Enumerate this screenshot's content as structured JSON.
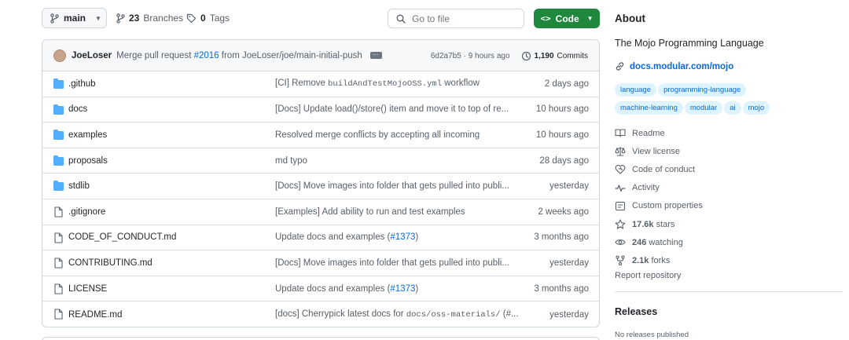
{
  "toolbar": {
    "branch": "main",
    "branches_count": "23",
    "branches_label": "Branches",
    "tags_count": "0",
    "tags_label": "Tags",
    "goto_placeholder": "Go to file",
    "code_label": "Code"
  },
  "latest_commit": {
    "author": "JoeLoser",
    "message_prefix": "Merge pull request",
    "pr_link": "#2016",
    "message_suffix": "from JoeLoser/joe/main-initial-push",
    "hash": "6d2a7b5",
    "separator": "·",
    "time": "9 hours ago",
    "commits_count": "1,190",
    "commits_label": "Commits"
  },
  "files": [
    {
      "type": "folder",
      "name": ".github",
      "msg_parts": [
        "[CI] Remove ",
        "buildAndTestMojoOSS.yml",
        " workflow"
      ],
      "date": "2 days ago"
    },
    {
      "type": "folder",
      "name": "docs",
      "msg_parts": [
        "[Docs] Update load()/store() item and move it to top of re...",
        "",
        ""
      ],
      "date": "10 hours ago"
    },
    {
      "type": "folder",
      "name": "examples",
      "msg_parts": [
        "Resolved merge conflicts by accepting all incoming",
        "",
        ""
      ],
      "date": "10 hours ago"
    },
    {
      "type": "folder",
      "name": "proposals",
      "msg_parts": [
        "md typo",
        "",
        ""
      ],
      "date": "28 days ago"
    },
    {
      "type": "folder",
      "name": "stdlib",
      "msg_parts": [
        "[Docs] Move images into folder that gets pulled into publi...",
        "",
        ""
      ],
      "date": "yesterday"
    },
    {
      "type": "file",
      "name": ".gitignore",
      "msg_parts": [
        "[Examples] Add ability to run and test examples",
        "",
        ""
      ],
      "date": "2 weeks ago"
    },
    {
      "type": "file",
      "name": "CODE_OF_CONDUCT.md",
      "msg_parts": [
        "Update docs and examples (",
        "#1373",
        ")"
      ],
      "date": "3 months ago"
    },
    {
      "type": "file",
      "name": "CONTRIBUTING.md",
      "msg_parts": [
        "[Docs] Move images into folder that gets pulled into publi...",
        "",
        ""
      ],
      "date": "yesterday"
    },
    {
      "type": "file",
      "name": "LICENSE",
      "msg_parts": [
        "Update docs and examples (",
        "#1373",
        ")"
      ],
      "date": "3 months ago"
    },
    {
      "type": "file",
      "name": "README.md",
      "msg_parts": [
        "[docs] Cherrypick latest docs for ",
        "docs/oss-materials/",
        " (#..."
      ],
      "date": "yesterday"
    }
  ],
  "about": {
    "title": "About",
    "description": "The Mojo Programming Language",
    "homepage": "docs.modular.com/mojo",
    "topics": [
      "language",
      "programming-language",
      "machine-learning",
      "modular",
      "ai",
      "mojo"
    ],
    "links": [
      {
        "icon": "book-icon",
        "label": "Readme",
        "bold": ""
      },
      {
        "icon": "law-icon",
        "label": "View license",
        "bold": ""
      },
      {
        "icon": "heart-icon",
        "label": "Code of conduct",
        "bold": ""
      },
      {
        "icon": "pulse-icon",
        "label": "Activity",
        "bold": ""
      },
      {
        "icon": "note-icon",
        "label": "Custom properties",
        "bold": ""
      },
      {
        "icon": "star-icon",
        "label": "stars",
        "bold": "17.6k"
      },
      {
        "icon": "eye-icon",
        "label": "watching",
        "bold": "246"
      },
      {
        "icon": "fork-icon",
        "label": "forks",
        "bold": "2.1k"
      }
    ],
    "report": "Report repository"
  },
  "releases": {
    "title": "Releases",
    "empty": "No releases published"
  },
  "colors": {
    "accent": "#0969da",
    "code_button": "#1f883d",
    "folder": "#54aeff",
    "topic_bg": "#ddf4ff"
  }
}
